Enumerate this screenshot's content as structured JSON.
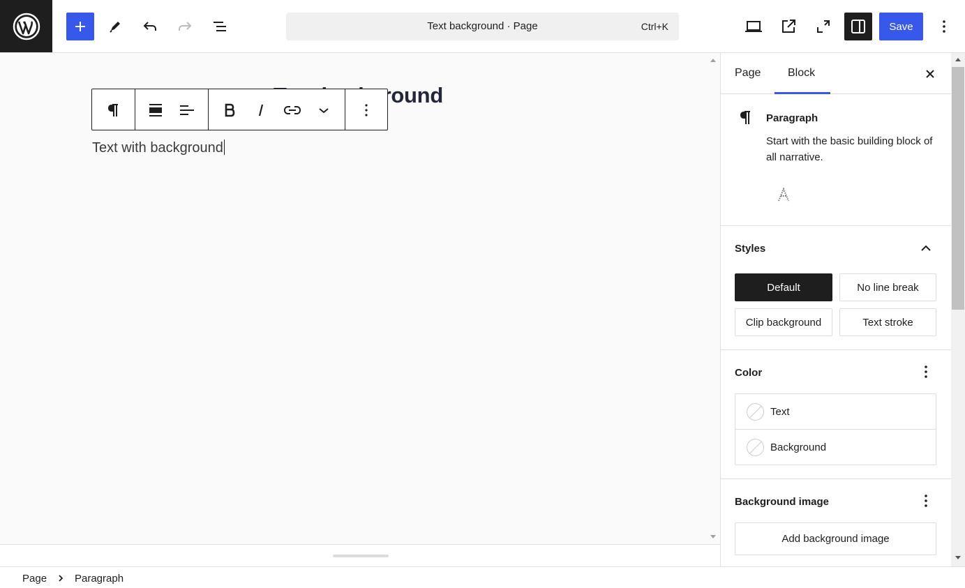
{
  "header": {
    "document_title": "Text background · Page",
    "shortcut": "Ctrl+K",
    "save_label": "Save",
    "icons": [
      "wordpress-logo",
      "plus-icon",
      "pencil-icon",
      "undo-icon",
      "redo-icon",
      "list-view-icon",
      "desktop-icon",
      "external-link-icon",
      "fullscreen-icon",
      "sidebar-icon",
      "kebab-icon"
    ],
    "accent_color": "#3858e9"
  },
  "canvas": {
    "page_heading": "Text background",
    "paragraph_text": "Text with background"
  },
  "block_toolbar": {
    "icons": [
      "paragraph-icon",
      "align-wide-icon",
      "align-left-icon",
      "bold-icon",
      "italic-icon",
      "link-icon",
      "chevron-down-icon",
      "more-options-icon"
    ]
  },
  "sidebar": {
    "tabs": [
      {
        "label": "Page",
        "active": false
      },
      {
        "label": "Block",
        "active": true
      }
    ],
    "block": {
      "name": "Paragraph",
      "description": "Start with the basic building block of all narrative."
    },
    "styles": {
      "title": "Styles",
      "options": [
        {
          "label": "Default",
          "active": true
        },
        {
          "label": "No line break",
          "active": false
        },
        {
          "label": "Clip background",
          "active": false
        },
        {
          "label": "Text stroke",
          "active": false
        }
      ]
    },
    "color": {
      "title": "Color",
      "items": [
        {
          "label": "Text"
        },
        {
          "label": "Background"
        }
      ]
    },
    "background_image": {
      "title": "Background image",
      "button_label": "Add background image"
    }
  },
  "breadcrumb": {
    "items": [
      "Page",
      "Paragraph"
    ]
  }
}
